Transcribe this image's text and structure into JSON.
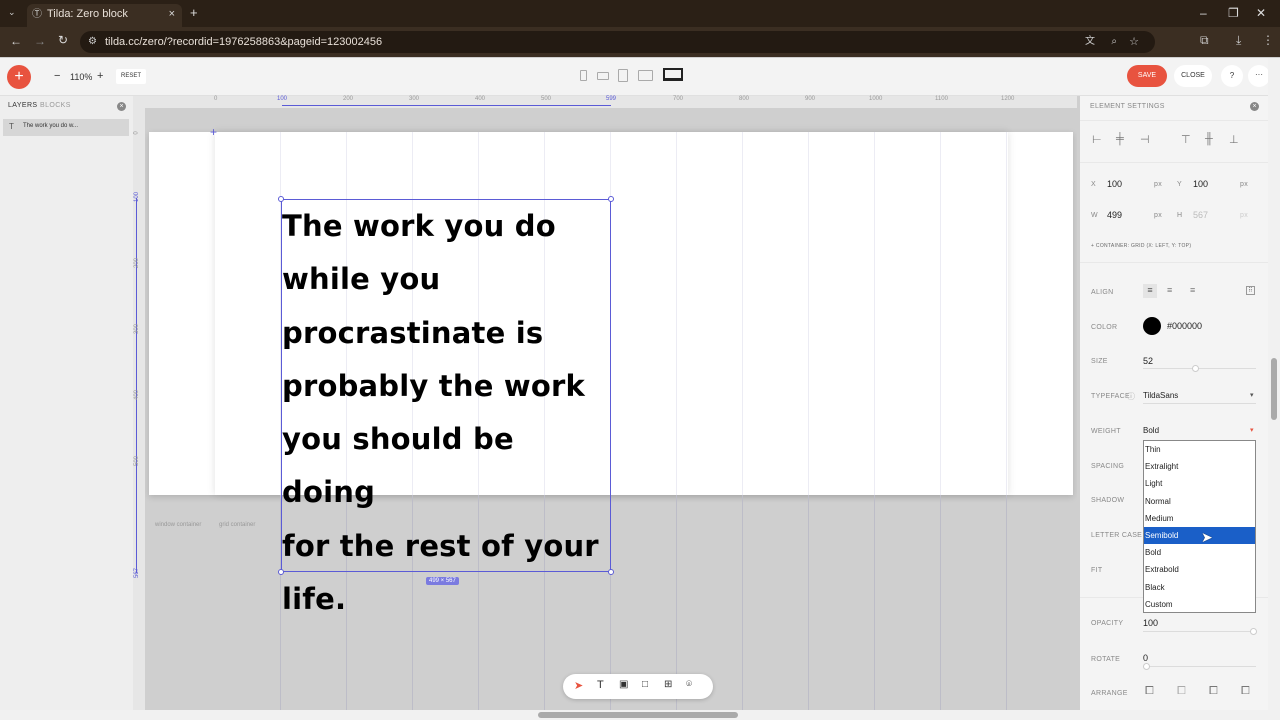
{
  "browser": {
    "tab_title": "Tilda: Zero block",
    "url": "tilda.cc/zero/?recordid=1976258863&pageid=123002456",
    "new_tab": "+"
  },
  "toolbar": {
    "zoom": "110%",
    "zoom_minus": "−",
    "zoom_plus": "+",
    "reset": "RESET",
    "save": "SAVE",
    "close": "CLOSE",
    "help": "?",
    "more": "···"
  },
  "left_panel": {
    "tab_layers": "LAYERS",
    "tab_blocks": "BLOCKS",
    "layer_item": "The work you do w..."
  },
  "ruler": {
    "h_ticks": [
      "0",
      "100",
      "200",
      "300",
      "400",
      "500",
      "599",
      "700",
      "800",
      "900",
      "1000",
      "1100",
      "1200"
    ],
    "v_ticks": [
      "0",
      "100",
      "200",
      "300",
      "400",
      "500",
      "567"
    ]
  },
  "canvas": {
    "text_lines": [
      "The work you do",
      "while you",
      "procrastinate is",
      "probably the work",
      "you should be doing",
      "for the rest of your",
      "life."
    ],
    "size_label": "499 × 567",
    "window_container": "window container",
    "grid_container": "grid container"
  },
  "settings": {
    "title": "ELEMENT SETTINGS",
    "x_label": "X",
    "x_value": "100",
    "x_unit": "px",
    "y_label": "Y",
    "y_value": "100",
    "y_unit": "px",
    "w_label": "W",
    "w_value": "499",
    "w_unit": "px",
    "h_label": "H",
    "h_value": "567",
    "h_unit": "px",
    "container_note": "+ CONTAINER: GRID (X: LEFT, Y: TOP)",
    "align_label": "ALIGN",
    "color_label": "COLOR",
    "color_value": "#000000",
    "size_label": "SIZE",
    "size_value": "52",
    "typeface_label": "TYPEFACE",
    "typeface_value": "TildaSans",
    "weight_label": "WEIGHT",
    "weight_value": "Bold",
    "spacing_label": "SPACING",
    "shadow_label": "SHADOW",
    "letter_case_label": "LETTER CASE",
    "fit_label": "FIT",
    "opacity_label": "OPACITY",
    "opacity_value": "100",
    "rotate_label": "ROTATE",
    "rotate_value": "0",
    "arrange_label": "ARRANGE",
    "weight_options": [
      "Thin",
      "Extralight",
      "Light",
      "Normal",
      "Medium",
      "Semibold",
      "Bold",
      "Extrabold",
      "Black",
      "Custom"
    ],
    "weight_highlighted": "Semibold"
  },
  "colors": {
    "accent": "#e8533f",
    "selection": "#1a5fc8",
    "guide": "#5b5bd6"
  }
}
